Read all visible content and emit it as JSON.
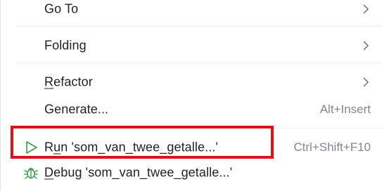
{
  "menu": {
    "items": [
      {
        "label": "Go To",
        "has_submenu": true
      },
      {
        "label": "Folding",
        "has_submenu": true
      },
      {
        "label_mnemonic": "R",
        "label_rest": "efactor",
        "has_submenu": true
      },
      {
        "label": "Generate...",
        "shortcut": "Alt+Insert"
      },
      {
        "label_pre": "R",
        "label_mnemonic": "u",
        "label_rest": "n 'som_van_twee_getalle...'",
        "shortcut": "Ctrl+Shift+F10",
        "icon": "run-icon"
      },
      {
        "label_mnemonic": "D",
        "label_rest": "ebug 'som_van_twee_getalle...'",
        "icon": "debug-icon"
      }
    ]
  },
  "colors": {
    "run_icon": "#3d9a50",
    "debug_icon": "#3d9a50",
    "highlight": "#e0101a",
    "shortcut_text": "#818594",
    "separator": "#ebecf0"
  }
}
